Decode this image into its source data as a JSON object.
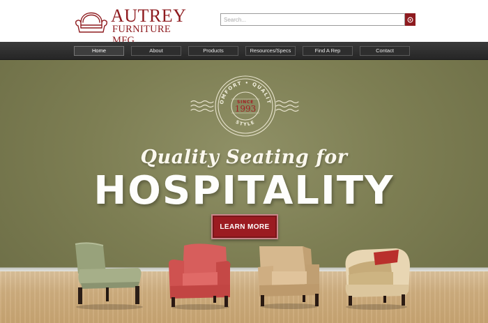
{
  "brand": {
    "name": "AUTREY",
    "sub": "FURNITURE MFG.",
    "color": "#8e1b1f"
  },
  "search": {
    "placeholder": "Search...",
    "icon": "search-icon"
  },
  "nav": {
    "items": [
      {
        "label": "Home",
        "active": true
      },
      {
        "label": "About"
      },
      {
        "label": "Products"
      },
      {
        "label": "Resources/Specs"
      },
      {
        "label": "Find A Rep"
      },
      {
        "label": "Contact"
      }
    ]
  },
  "hero": {
    "badge": {
      "arc_top": "COMFORT • QUALITY",
      "since": "SINCE",
      "year": "1993",
      "arc_bottom": "STYLE"
    },
    "tagline": "Quality Seating for",
    "headline": "HOSPITALITY",
    "cta": "LEARN MORE",
    "colors": {
      "wall": "#7d7e53",
      "floor": "#cfae7f",
      "cta": "#9b1b21"
    }
  }
}
